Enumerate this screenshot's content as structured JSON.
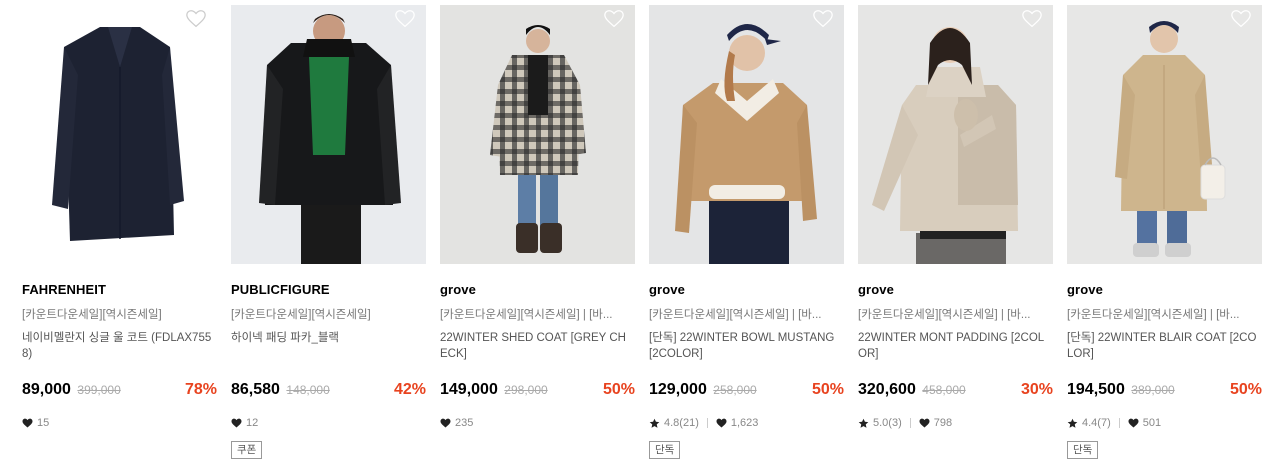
{
  "products": [
    {
      "brand": "FAHRENHEIT",
      "promo": "[카운트다운세일][역시즌세일]",
      "name": "네이비멜란지 싱글 울 코트 (FDLAX7558)",
      "price": "89,000",
      "original_price": "399,000",
      "discount": "78%",
      "likes": "15",
      "badge": ""
    },
    {
      "brand": "PUBLICFIGURE",
      "promo": "[카운트다운세일][역시즌세일]",
      "name": "하이넥 패딩 파카_블랙",
      "price": "86,580",
      "original_price": "148,000",
      "discount": "42%",
      "likes": "12",
      "badge": "쿠폰"
    },
    {
      "brand": "grove",
      "promo": "[카운트다운세일][역시즌세일] | [바...",
      "name": "22WINTER SHED COAT [GREY CHECK]",
      "price": "149,000",
      "original_price": "298,000",
      "discount": "50%",
      "likes": "235",
      "badge": ""
    },
    {
      "brand": "grove",
      "promo": "[카운트다운세일][역시즌세일] | [바...",
      "name": "[단독] 22WINTER BOWL MUSTANG [2COLOR]",
      "price": "129,000",
      "original_price": "258,000",
      "discount": "50%",
      "rating": "4.8(21)",
      "likes": "1,623",
      "badge": "단독"
    },
    {
      "brand": "grove",
      "promo": "[카운트다운세일][역시즌세일] | [바...",
      "name": "22WINTER MONT PADDING [2COLOR]",
      "price": "320,600",
      "original_price": "458,000",
      "discount": "30%",
      "rating": "5.0(3)",
      "likes": "798",
      "badge": ""
    },
    {
      "brand": "grove",
      "promo": "[카운트다운세일][역시즌세일] | [바...",
      "name": "[단독] 22WINTER BLAIR COAT [2COLOR]",
      "price": "194,500",
      "original_price": "389,000",
      "discount": "50%",
      "rating": "4.4(7)",
      "likes": "501",
      "badge": "단독"
    }
  ],
  "colors": {
    "discount": "#e8431f",
    "muted": "#888888"
  },
  "icons": {
    "wish": "heart-outline-icon",
    "likes": "heart-filled-icon",
    "rating": "star-icon"
  }
}
